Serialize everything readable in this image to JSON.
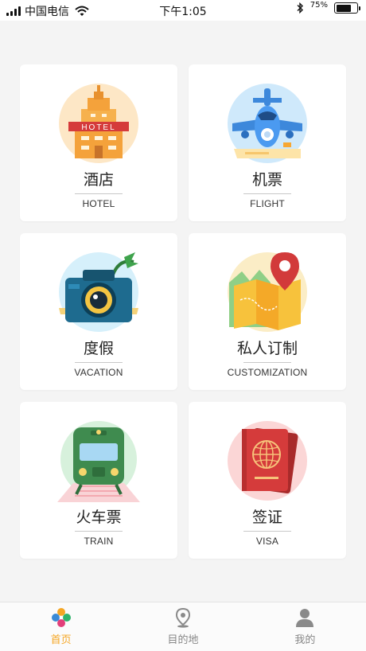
{
  "status_bar": {
    "carrier": "中国电信",
    "time": "下午1:05",
    "battery_percent": "75%",
    "battery_level": 0.75
  },
  "services": [
    {
      "title": "酒店",
      "subtitle": "HOTEL",
      "icon": "hotel-icon",
      "sign": "HOTEL"
    },
    {
      "title": "机票",
      "subtitle": "FLIGHT",
      "icon": "airplane-icon"
    },
    {
      "title": "度假",
      "subtitle": "VACATION",
      "icon": "camera-icon"
    },
    {
      "title": "私人订制",
      "subtitle": "CUSTOMIZATION",
      "icon": "map-pin-icon"
    },
    {
      "title": "火车票",
      "subtitle": "TRAIN",
      "icon": "train-icon"
    },
    {
      "title": "签证",
      "subtitle": "VISA",
      "icon": "passport-icon"
    }
  ],
  "tabbar": {
    "items": [
      {
        "label": "首页",
        "icon": "home-icon",
        "active": true
      },
      {
        "label": "目的地",
        "icon": "location-icon",
        "active": false
      },
      {
        "label": "我的",
        "icon": "user-icon",
        "active": false
      }
    ],
    "active_color": "#f5a623",
    "inactive_color": "#888888"
  }
}
